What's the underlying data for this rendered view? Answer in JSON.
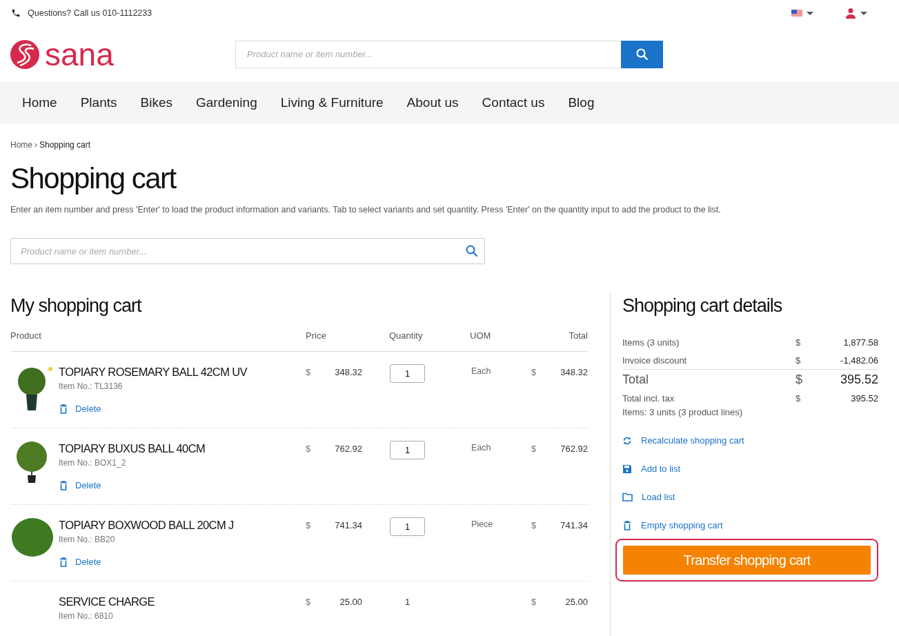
{
  "topbar": {
    "phone_text": "Questions? Call us 010-1112233"
  },
  "header": {
    "logo": "sana",
    "search": {
      "placeholder": "Product name or item number..."
    }
  },
  "nav": {
    "items": [
      {
        "label": "Home"
      },
      {
        "label": "Plants"
      },
      {
        "label": "Bikes"
      },
      {
        "label": "Gardening"
      },
      {
        "label": "Living & Furniture"
      },
      {
        "label": "About us"
      },
      {
        "label": "Contact us"
      },
      {
        "label": "Blog"
      }
    ]
  },
  "breadcrumb": [
    {
      "label": "Home",
      "kind": "link"
    },
    {
      "label": "Shopping cart",
      "kind": "current"
    }
  ],
  "breadcrumb_separator": "›",
  "page_title": "Shopping cart",
  "instructions": "Enter an item number and press 'Enter' to load the product information and variants. Tab to select variants and set quantity. Press 'Enter' on the quantity input to add the product to the list.",
  "quick_order_search": {
    "placeholder": "Product name or item number..."
  },
  "cart": {
    "title": "My shopping cart",
    "columns": [
      "Product",
      "Price",
      "Quantity",
      "UOM",
      "Total"
    ],
    "rows": [
      {
        "kind": "product",
        "marked": true,
        "name": "TOPIARY ROSEMARY BALL 42CM UV",
        "item_no": "Item No.: TL3136",
        "currency": "$",
        "price": "348.32",
        "quantity": "1",
        "uom": "Each",
        "total_currency": "$",
        "total": "348.32",
        "delete": "Delete"
      },
      {
        "kind": "product",
        "marked": false,
        "name": "TOPIARY BUXUS BALL 40CM",
        "item_no": "Item No.: BOX1_2",
        "currency": "$",
        "price": "762.92",
        "quantity": "1",
        "uom": "Each",
        "total_currency": "$",
        "total": "762.92",
        "delete": "Delete"
      },
      {
        "kind": "product",
        "marked": false,
        "name": "TOPIARY BOXWOOD BALL 20CM J",
        "item_no": "Item No.: BB20",
        "currency": "$",
        "price": "741.34",
        "quantity": "1",
        "uom": "Piece",
        "total_currency": "$",
        "total": "741.34",
        "delete": "Delete"
      },
      {
        "kind": "charge",
        "name": "SERVICE CHARGE",
        "item_no": "Item No.: 6810",
        "currency": "$",
        "price": "25.00",
        "quantity": "1",
        "total_currency": "$",
        "total": "25.00"
      }
    ]
  },
  "details": {
    "title": "Shopping cart details",
    "lines": [
      {
        "kind": "line",
        "label": "Items (3 units)",
        "currency": "$",
        "value": "1,877.58"
      },
      {
        "kind": "line",
        "label": "Invoice discount",
        "currency": "$",
        "value": "-1,482.06"
      },
      {
        "kind": "total",
        "label": "Total",
        "currency": "$",
        "value": "395.52"
      },
      {
        "kind": "line",
        "label": "Total incl. tax",
        "currency": "$",
        "value": "395.52"
      }
    ],
    "summary": "Items: 3 units (3 product lines)",
    "actions": [
      {
        "kind": "recalculate",
        "label": "Recalculate shopping cart"
      },
      {
        "kind": "save",
        "label": "Add to list"
      },
      {
        "kind": "folder",
        "label": "Load list"
      },
      {
        "kind": "trash",
        "label": "Empty shopping cart"
      }
    ],
    "primary_button": "Transfer shopping cart",
    "highlighted": true
  }
}
